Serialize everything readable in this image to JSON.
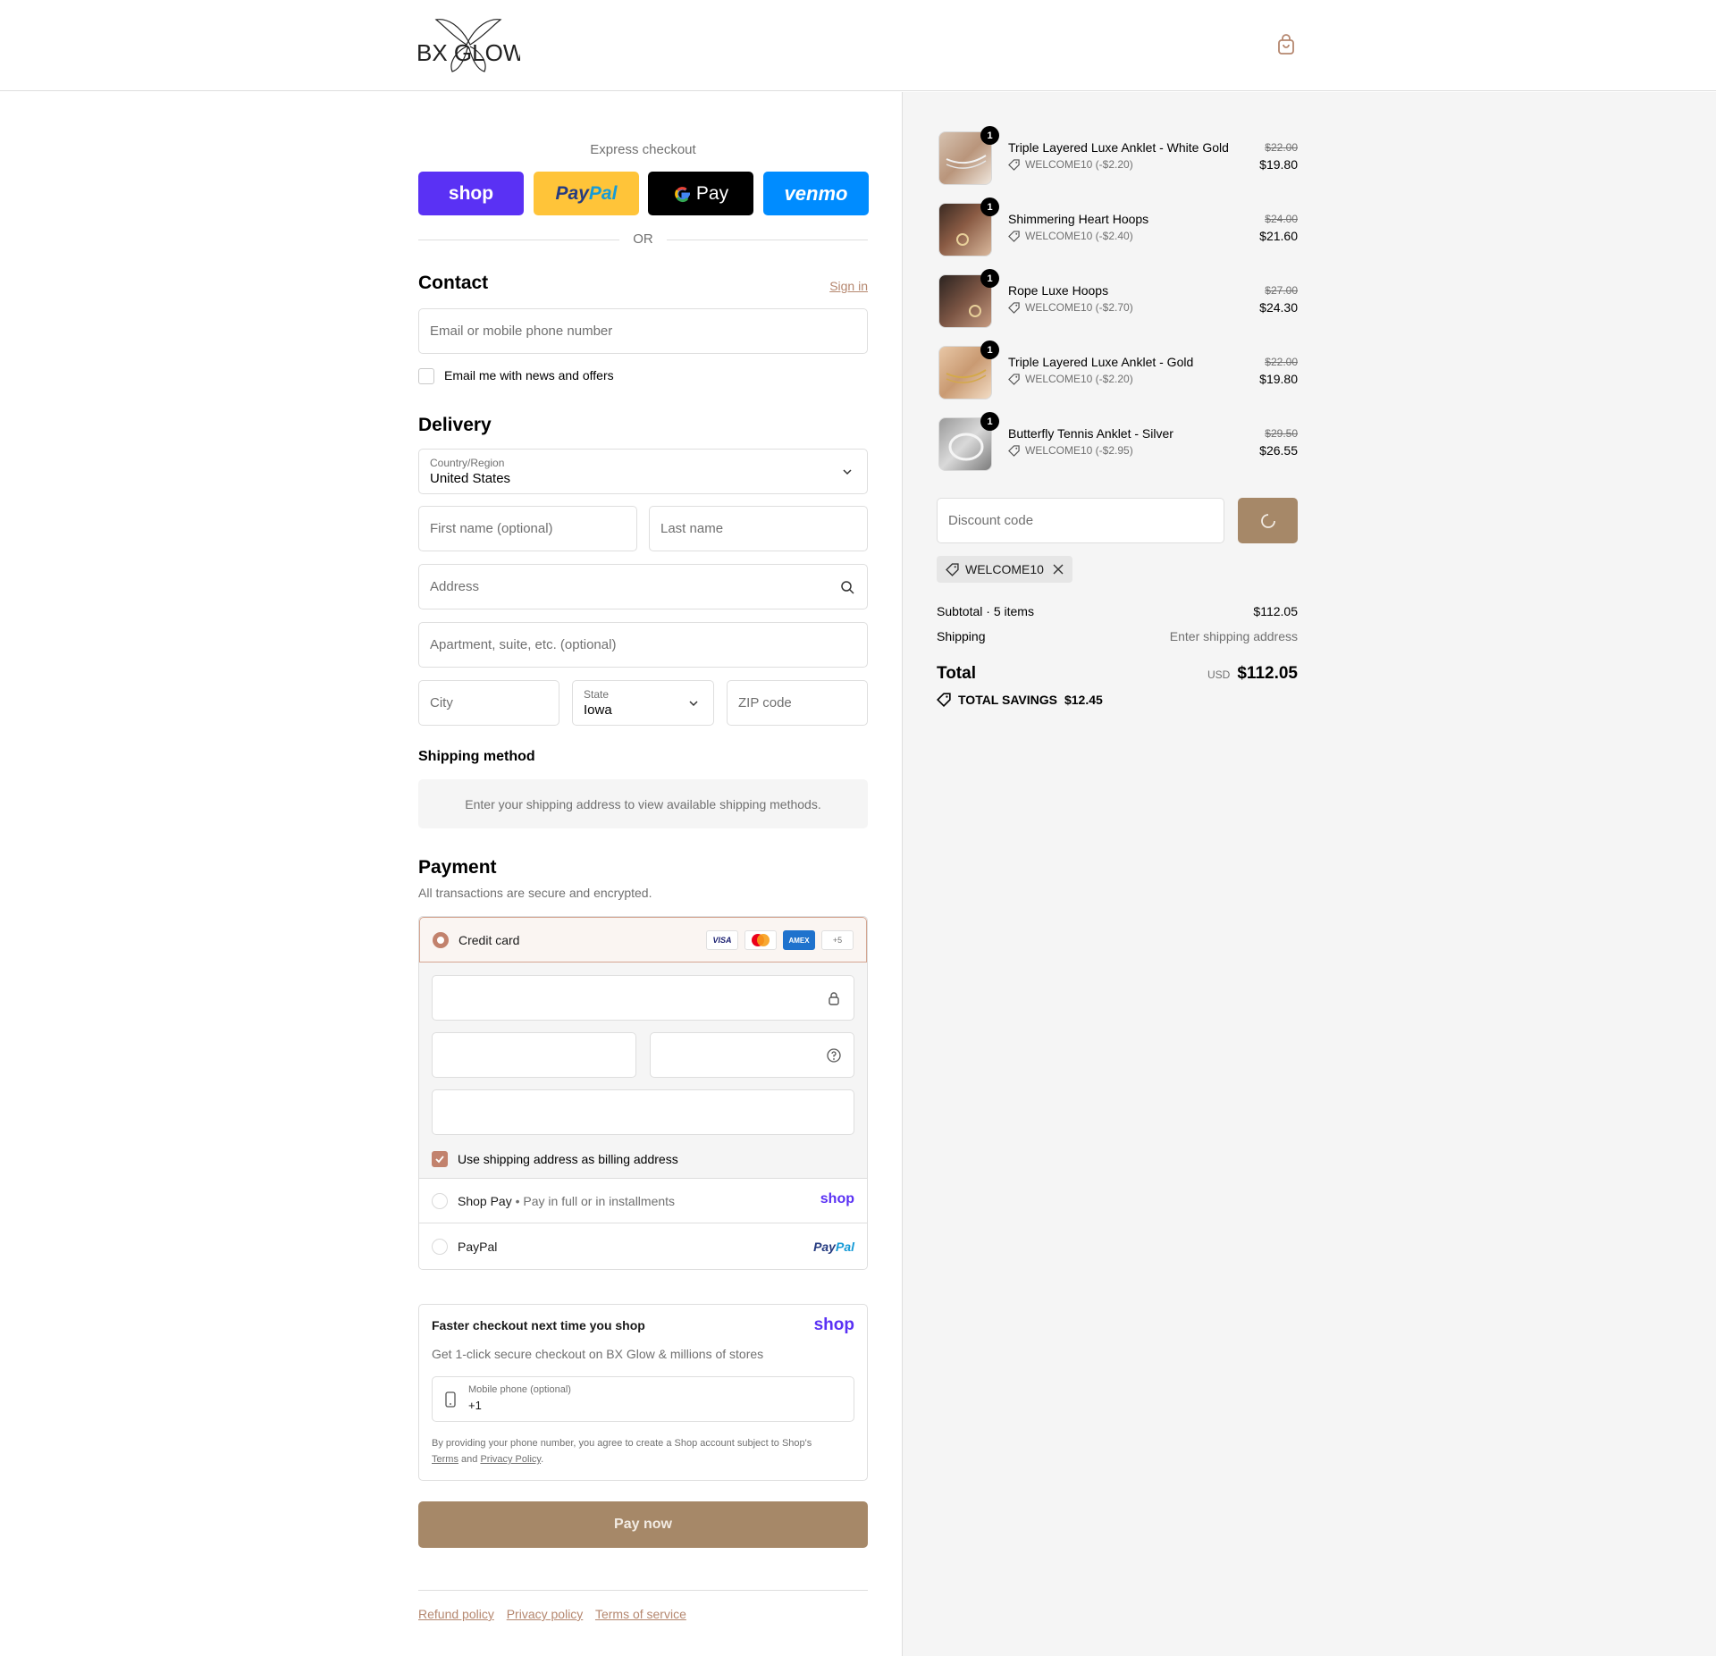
{
  "brand": {
    "logo_text": "BX GLOW"
  },
  "express": {
    "title": "Express checkout",
    "shop": "shop",
    "paypal_a": "Pay",
    "paypal_b": "Pal",
    "gpay": "Pay",
    "venmo": "venmo",
    "or": "OR"
  },
  "contact": {
    "heading": "Contact",
    "sign_in": "Sign in",
    "email_placeholder": "Email or mobile phone number",
    "news_label": "Email me with news and offers"
  },
  "delivery": {
    "heading": "Delivery",
    "country_label": "Country/Region",
    "country_value": "United States",
    "first_name": "First name (optional)",
    "last_name": "Last name",
    "address": "Address",
    "apartment": "Apartment, suite, etc. (optional)",
    "city": "City",
    "state_label": "State",
    "state_value": "Iowa",
    "zip": "ZIP code"
  },
  "shipping_method": {
    "heading": "Shipping method",
    "notice": "Enter your shipping address to view available shipping methods."
  },
  "payment": {
    "heading": "Payment",
    "subtitle": "All transactions are secure and encrypted.",
    "credit_card": "Credit card",
    "cards": [
      "VISA",
      "AMEX",
      "+5"
    ],
    "billing_label": "Use shipping address as billing address",
    "shop_pay": "Shop Pay",
    "shop_pay_sub": "Pay in full or in installments",
    "shop_pay_logo": "shop",
    "paypal": "PayPal",
    "paypal_logo_a": "Pay",
    "paypal_logo_b": "Pal"
  },
  "faster": {
    "title": "Faster checkout next time you shop",
    "logo": "shop",
    "subtitle": "Get 1-click secure checkout on BX Glow & millions of stores",
    "phone_label": "Mobile phone (optional)",
    "phone_value": "+1",
    "legal_a": "By providing your phone number, you agree to create a Shop account subject to Shop's",
    "terms": "Terms",
    "and": "and",
    "privacy": "Privacy Policy",
    "period": "."
  },
  "pay_now": "Pay now",
  "footer_links": [
    "Refund policy",
    "Privacy policy",
    "Terms of service"
  ],
  "summary": {
    "items": [
      {
        "qty": "1",
        "name": "Triple Layered Luxe Anklet - White Gold",
        "discount": "WELCOME10 (-$2.20)",
        "old": "$22.00",
        "new": "$19.80"
      },
      {
        "qty": "1",
        "name": "Shimmering Heart Hoops",
        "discount": "WELCOME10 (-$2.40)",
        "old": "$24.00",
        "new": "$21.60"
      },
      {
        "qty": "1",
        "name": "Rope Luxe Hoops",
        "discount": "WELCOME10 (-$2.70)",
        "old": "$27.00",
        "new": "$24.30"
      },
      {
        "qty": "1",
        "name": "Triple Layered Luxe Anklet - Gold",
        "discount": "WELCOME10 (-$2.20)",
        "old": "$22.00",
        "new": "$19.80"
      },
      {
        "qty": "1",
        "name": "Butterfly Tennis Anklet - Silver",
        "discount": "WELCOME10 (-$2.95)",
        "old": "$29.50",
        "new": "$26.55"
      }
    ],
    "discount_placeholder": "Discount code",
    "applied_code": "WELCOME10",
    "subtotal_label": "Subtotal · 5 items",
    "subtotal_value": "$112.05",
    "shipping_label": "Shipping",
    "shipping_value": "Enter shipping address",
    "total_label": "Total",
    "currency": "USD",
    "total_value": "$112.05",
    "savings_label": "TOTAL SAVINGS",
    "savings_value": "$12.45"
  },
  "colors": {
    "accent": "#a68868",
    "link": "#b5876f",
    "shop_purple": "#5a31f4",
    "paypal_yellow": "#ffc439",
    "venmo_blue": "#008cff"
  }
}
